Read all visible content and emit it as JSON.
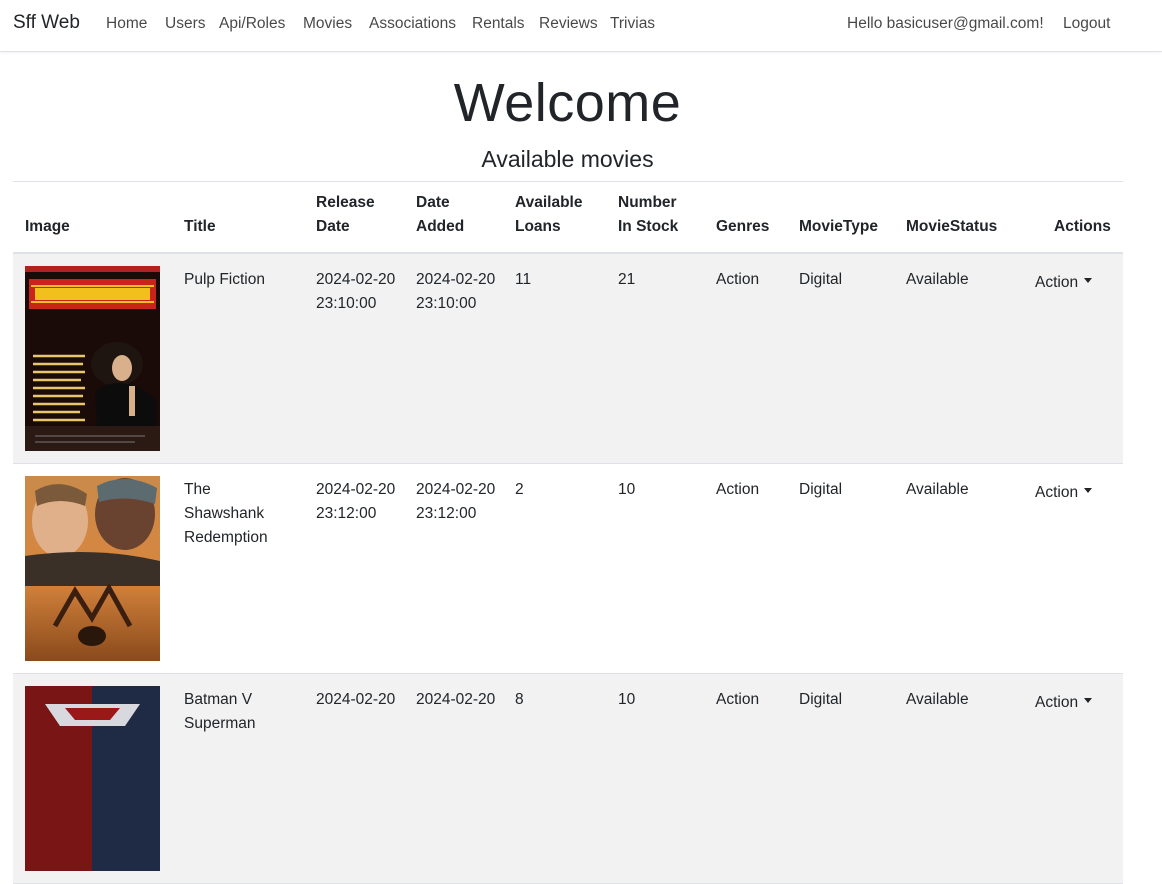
{
  "navbar": {
    "brand": "Sff Web",
    "links": [
      "Home",
      "Users",
      "Api/Roles",
      "Movies",
      "Associations",
      "Rentals",
      "Reviews",
      "Trivias"
    ],
    "greeting": "Hello basicuser@gmail.com!",
    "logout": "Logout"
  },
  "main": {
    "title": "Welcome",
    "subtitle": "Available movies"
  },
  "table": {
    "headers": {
      "image": "Image",
      "title": "Title",
      "release_line1": "Release",
      "release_line2": "Date",
      "added_line1": "Date",
      "added_line2": "Added",
      "loans_line1": "Available",
      "loans_line2": "Loans",
      "stock_line1": "Number",
      "stock_line2": "In Stock",
      "genres": "Genres",
      "type": "MovieType",
      "status": "MovieStatus",
      "actions": "Actions"
    },
    "rows": [
      {
        "title": "Pulp Fiction",
        "release": "2024-02-20 23:10:00",
        "added": "2024-02-20 23:10:00",
        "loans": "11",
        "stock": "21",
        "genres": "Action",
        "type": "Digital",
        "status": "Available",
        "action": "Action"
      },
      {
        "title": "The Shawshank Redemption",
        "release": "2024-02-20 23:12:00",
        "added": "2024-02-20 23:12:00",
        "loans": "2",
        "stock": "10",
        "genres": "Action",
        "type": "Digital",
        "status": "Available",
        "action": "Action"
      },
      {
        "title": "Batman V Superman",
        "release": "2024-02-20",
        "added": "2024-02-20",
        "loans": "8",
        "stock": "10",
        "genres": "Action",
        "type": "Digital",
        "status": "Available",
        "action": "Action"
      }
    ]
  }
}
